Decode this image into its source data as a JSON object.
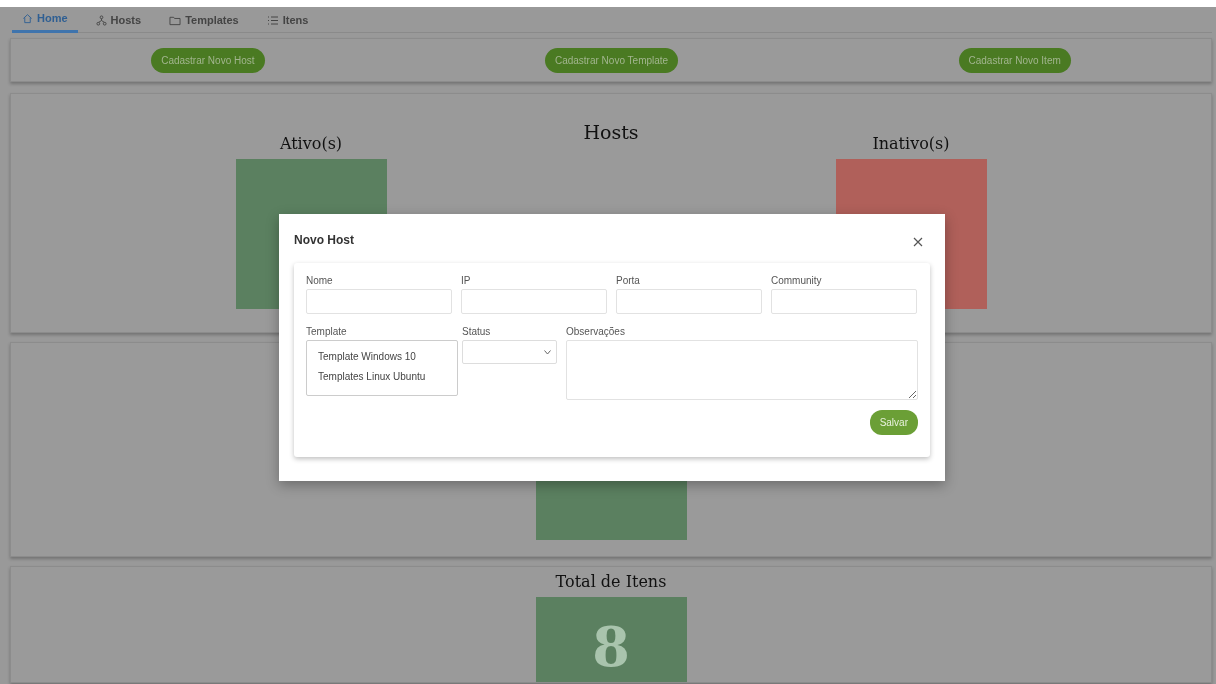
{
  "nav": {
    "tabs": [
      {
        "label": "Home",
        "selected": true
      },
      {
        "label": "Hosts",
        "selected": false
      },
      {
        "label": "Templates",
        "selected": false
      },
      {
        "label": "Itens",
        "selected": false
      }
    ]
  },
  "actions": [
    "Cadastrar Novo Host",
    "Cadastrar Novo Template",
    "Cadastrar Novo Item"
  ],
  "hosts_panel": {
    "title": "Hosts",
    "groups": [
      {
        "label": "Ativo(s)",
        "color": "#5b8060"
      },
      {
        "label": "Inativo(s)",
        "color": "#b0605a"
      }
    ]
  },
  "items_panel": {
    "title": "Total de Itens",
    "value": "8"
  },
  "modal": {
    "title": "Novo Host",
    "fields": [
      {
        "label": "Nome"
      },
      {
        "label": "IP"
      },
      {
        "label": "Porta"
      },
      {
        "label": "Community"
      }
    ],
    "template": {
      "label": "Template",
      "options": [
        "Template Windows 10",
        "Templates Linux Ubuntu"
      ]
    },
    "status": {
      "label": "Status"
    },
    "notes": {
      "label": "Observações"
    },
    "submit": "Salvar"
  }
}
